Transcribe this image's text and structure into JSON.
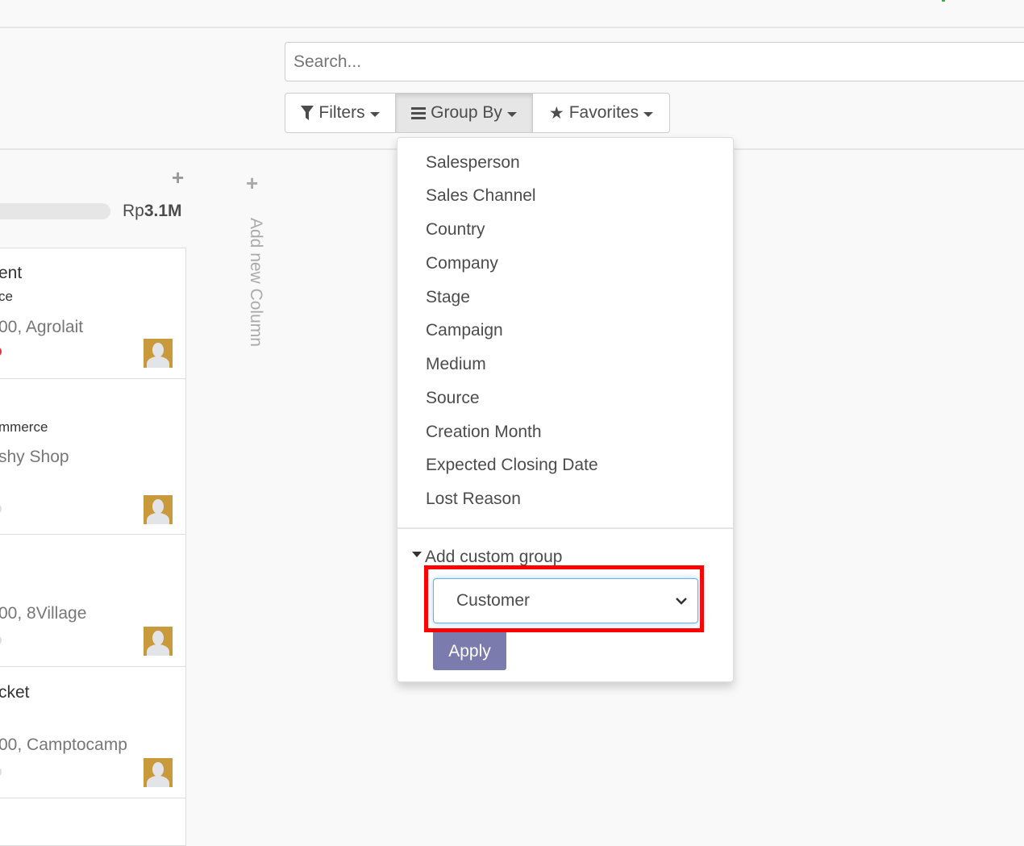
{
  "search": {
    "placeholder": "Search..."
  },
  "toolbar": {
    "filters": "Filters",
    "group_by": "Group By",
    "favorites": "Favorites"
  },
  "group_by_menu": {
    "items": [
      "Salesperson",
      "Sales Channel",
      "Country",
      "Company",
      "Stage",
      "Campaign",
      "Medium",
      "Source",
      "Creation Month",
      "Expected Closing Date",
      "Lost Reason"
    ],
    "custom_group_label": "Add custom group",
    "custom_group_selected": "Customer",
    "apply_label": "Apply"
  },
  "kanban": {
    "column_total_prefix": "Rp",
    "column_total_value": "3.1M",
    "add_column_label": "Add new Column",
    "cards": [
      {
        "title": "ent",
        "tag": "ce",
        "subtitle": "00, Agrolait",
        "priority_color": "#e2343f"
      },
      {
        "title": "",
        "tag": "mmerce",
        "subtitle": "shy Shop",
        "priority_color": "#dddddd"
      },
      {
        "title": "",
        "tag": "",
        "subtitle": "00, 8Village",
        "priority_color": "#dddddd"
      },
      {
        "title": "cket",
        "tag": "",
        "subtitle": "00, Camptocamp",
        "priority_color": "#dddddd"
      }
    ]
  },
  "colors": {
    "apply_button": "#7c7bad",
    "highlight": "#ff0000",
    "select_focus": "#66afe9"
  }
}
